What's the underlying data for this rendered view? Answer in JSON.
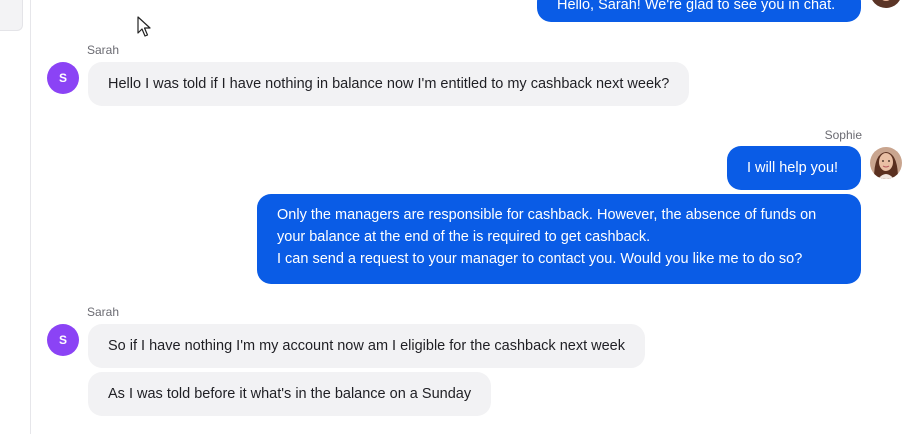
{
  "conversation": {
    "top_message": {
      "text": "Hello, Sarah! We're glad to see you in chat."
    },
    "msg_sarah_1": {
      "sender": "Sarah",
      "avatar_initial": "S",
      "text": "Hello I was told if I have nothing in balance now I'm entitled to my cashback next week?"
    },
    "msg_sophie": {
      "sender": "Sophie",
      "text_short": "I will help you!",
      "text_long": [
        "Only the managers are responsible for cashback. However, the absence of funds on",
        "your balance at the end of the is required to get cashback.",
        "I can send a request to your manager to contact you. Would you like me to do so?"
      ]
    },
    "msg_sarah_2": {
      "sender": "Sarah",
      "avatar_initial": "S",
      "text_1": "So if I have nothing I'm my account now am I eligible for the cashback next week",
      "text_2": "As I was told before it what's in the balance on a Sunday"
    }
  },
  "colors": {
    "agent_bubble": "#0a5ce6",
    "user_bubble": "#f2f2f4",
    "user_avatar": "#8b43f5"
  },
  "icons": {
    "agent_avatar": "agent-photo-avatar",
    "cursor": "mouse-pointer-icon"
  }
}
